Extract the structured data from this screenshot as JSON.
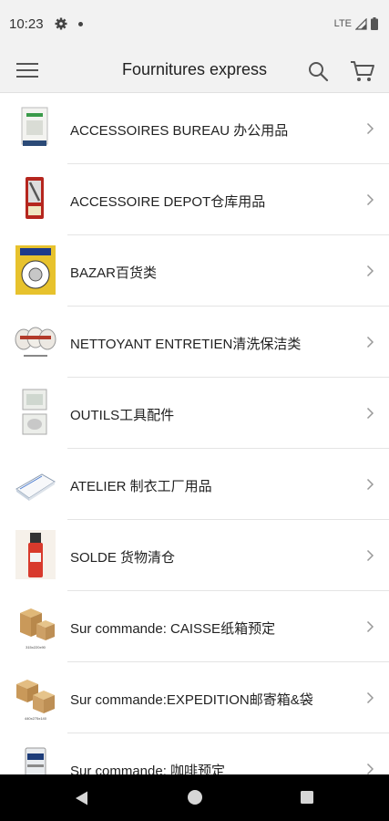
{
  "status_bar": {
    "time": "10:23",
    "network": "LTE",
    "icons": [
      "gear-icon",
      "notification-dot-icon",
      "signal-icon",
      "battery-icon"
    ]
  },
  "app_bar": {
    "title": "Fournitures express",
    "icons": [
      "menu-icon",
      "search-icon",
      "cart-icon"
    ]
  },
  "categories": [
    {
      "label": "ACCESSOIRES BUREAU 办公用品",
      "thumb": "office-supplies-thumb"
    },
    {
      "label": "ACCESSOIRE DEPOT仓库用品",
      "thumb": "warehouse-supplies-thumb"
    },
    {
      "label": "BAZAR百货类",
      "thumb": "bazaar-thumb"
    },
    {
      "label": "NETTOYANT ENTRETIEN清洗保洁类",
      "thumb": "cleaning-thumb"
    },
    {
      "label": "OUTILS工具配件",
      "thumb": "tools-thumb"
    },
    {
      "label": "ATELIER 制衣工厂用品",
      "thumb": "workshop-thumb"
    },
    {
      "label": "SOLDE 货物清仓",
      "thumb": "clearance-thumb"
    },
    {
      "label": "Sur commande: CAISSE纸箱预定",
      "thumb": "boxes-order-thumb",
      "caption": "315x220x90"
    },
    {
      "label": "Sur commande:EXPEDITION邮寄箱&袋",
      "thumb": "shipping-order-thumb",
      "caption": "440x275x140"
    },
    {
      "label": "Sur commande: 咖啡预定",
      "thumb": "coffee-order-thumb"
    }
  ],
  "nav_bar": {
    "icons": [
      "back-icon",
      "home-icon",
      "recents-icon"
    ]
  }
}
